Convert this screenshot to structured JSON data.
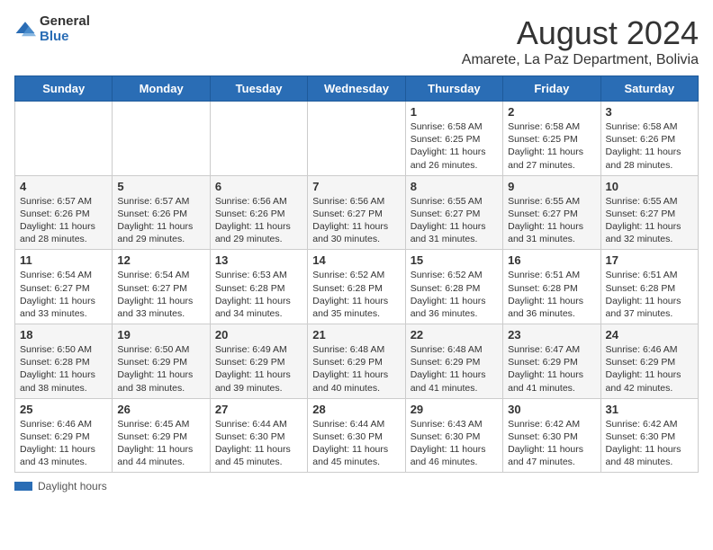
{
  "header": {
    "logo_general": "General",
    "logo_blue": "Blue",
    "month_title": "August 2024",
    "subtitle": "Amarete, La Paz Department, Bolivia"
  },
  "weekdays": [
    "Sunday",
    "Monday",
    "Tuesday",
    "Wednesday",
    "Thursday",
    "Friday",
    "Saturday"
  ],
  "weeks": [
    [
      {
        "day": "",
        "sunrise": "",
        "sunset": "",
        "daylight": ""
      },
      {
        "day": "",
        "sunrise": "",
        "sunset": "",
        "daylight": ""
      },
      {
        "day": "",
        "sunrise": "",
        "sunset": "",
        "daylight": ""
      },
      {
        "day": "",
        "sunrise": "",
        "sunset": "",
        "daylight": ""
      },
      {
        "day": "1",
        "sunrise": "Sunrise: 6:58 AM",
        "sunset": "Sunset: 6:25 PM",
        "daylight": "Daylight: 11 hours and 26 minutes."
      },
      {
        "day": "2",
        "sunrise": "Sunrise: 6:58 AM",
        "sunset": "Sunset: 6:25 PM",
        "daylight": "Daylight: 11 hours and 27 minutes."
      },
      {
        "day": "3",
        "sunrise": "Sunrise: 6:58 AM",
        "sunset": "Sunset: 6:26 PM",
        "daylight": "Daylight: 11 hours and 28 minutes."
      }
    ],
    [
      {
        "day": "4",
        "sunrise": "Sunrise: 6:57 AM",
        "sunset": "Sunset: 6:26 PM",
        "daylight": "Daylight: 11 hours and 28 minutes."
      },
      {
        "day": "5",
        "sunrise": "Sunrise: 6:57 AM",
        "sunset": "Sunset: 6:26 PM",
        "daylight": "Daylight: 11 hours and 29 minutes."
      },
      {
        "day": "6",
        "sunrise": "Sunrise: 6:56 AM",
        "sunset": "Sunset: 6:26 PM",
        "daylight": "Daylight: 11 hours and 29 minutes."
      },
      {
        "day": "7",
        "sunrise": "Sunrise: 6:56 AM",
        "sunset": "Sunset: 6:27 PM",
        "daylight": "Daylight: 11 hours and 30 minutes."
      },
      {
        "day": "8",
        "sunrise": "Sunrise: 6:55 AM",
        "sunset": "Sunset: 6:27 PM",
        "daylight": "Daylight: 11 hours and 31 minutes."
      },
      {
        "day": "9",
        "sunrise": "Sunrise: 6:55 AM",
        "sunset": "Sunset: 6:27 PM",
        "daylight": "Daylight: 11 hours and 31 minutes."
      },
      {
        "day": "10",
        "sunrise": "Sunrise: 6:55 AM",
        "sunset": "Sunset: 6:27 PM",
        "daylight": "Daylight: 11 hours and 32 minutes."
      }
    ],
    [
      {
        "day": "11",
        "sunrise": "Sunrise: 6:54 AM",
        "sunset": "Sunset: 6:27 PM",
        "daylight": "Daylight: 11 hours and 33 minutes."
      },
      {
        "day": "12",
        "sunrise": "Sunrise: 6:54 AM",
        "sunset": "Sunset: 6:27 PM",
        "daylight": "Daylight: 11 hours and 33 minutes."
      },
      {
        "day": "13",
        "sunrise": "Sunrise: 6:53 AM",
        "sunset": "Sunset: 6:28 PM",
        "daylight": "Daylight: 11 hours and 34 minutes."
      },
      {
        "day": "14",
        "sunrise": "Sunrise: 6:52 AM",
        "sunset": "Sunset: 6:28 PM",
        "daylight": "Daylight: 11 hours and 35 minutes."
      },
      {
        "day": "15",
        "sunrise": "Sunrise: 6:52 AM",
        "sunset": "Sunset: 6:28 PM",
        "daylight": "Daylight: 11 hours and 36 minutes."
      },
      {
        "day": "16",
        "sunrise": "Sunrise: 6:51 AM",
        "sunset": "Sunset: 6:28 PM",
        "daylight": "Daylight: 11 hours and 36 minutes."
      },
      {
        "day": "17",
        "sunrise": "Sunrise: 6:51 AM",
        "sunset": "Sunset: 6:28 PM",
        "daylight": "Daylight: 11 hours and 37 minutes."
      }
    ],
    [
      {
        "day": "18",
        "sunrise": "Sunrise: 6:50 AM",
        "sunset": "Sunset: 6:28 PM",
        "daylight": "Daylight: 11 hours and 38 minutes."
      },
      {
        "day": "19",
        "sunrise": "Sunrise: 6:50 AM",
        "sunset": "Sunset: 6:29 PM",
        "daylight": "Daylight: 11 hours and 38 minutes."
      },
      {
        "day": "20",
        "sunrise": "Sunrise: 6:49 AM",
        "sunset": "Sunset: 6:29 PM",
        "daylight": "Daylight: 11 hours and 39 minutes."
      },
      {
        "day": "21",
        "sunrise": "Sunrise: 6:48 AM",
        "sunset": "Sunset: 6:29 PM",
        "daylight": "Daylight: 11 hours and 40 minutes."
      },
      {
        "day": "22",
        "sunrise": "Sunrise: 6:48 AM",
        "sunset": "Sunset: 6:29 PM",
        "daylight": "Daylight: 11 hours and 41 minutes."
      },
      {
        "day": "23",
        "sunrise": "Sunrise: 6:47 AM",
        "sunset": "Sunset: 6:29 PM",
        "daylight": "Daylight: 11 hours and 41 minutes."
      },
      {
        "day": "24",
        "sunrise": "Sunrise: 6:46 AM",
        "sunset": "Sunset: 6:29 PM",
        "daylight": "Daylight: 11 hours and 42 minutes."
      }
    ],
    [
      {
        "day": "25",
        "sunrise": "Sunrise: 6:46 AM",
        "sunset": "Sunset: 6:29 PM",
        "daylight": "Daylight: 11 hours and 43 minutes."
      },
      {
        "day": "26",
        "sunrise": "Sunrise: 6:45 AM",
        "sunset": "Sunset: 6:29 PM",
        "daylight": "Daylight: 11 hours and 44 minutes."
      },
      {
        "day": "27",
        "sunrise": "Sunrise: 6:44 AM",
        "sunset": "Sunset: 6:30 PM",
        "daylight": "Daylight: 11 hours and 45 minutes."
      },
      {
        "day": "28",
        "sunrise": "Sunrise: 6:44 AM",
        "sunset": "Sunset: 6:30 PM",
        "daylight": "Daylight: 11 hours and 45 minutes."
      },
      {
        "day": "29",
        "sunrise": "Sunrise: 6:43 AM",
        "sunset": "Sunset: 6:30 PM",
        "daylight": "Daylight: 11 hours and 46 minutes."
      },
      {
        "day": "30",
        "sunrise": "Sunrise: 6:42 AM",
        "sunset": "Sunset: 6:30 PM",
        "daylight": "Daylight: 11 hours and 47 minutes."
      },
      {
        "day": "31",
        "sunrise": "Sunrise: 6:42 AM",
        "sunset": "Sunset: 6:30 PM",
        "daylight": "Daylight: 11 hours and 48 minutes."
      }
    ]
  ],
  "footer": {
    "daylight_label": "Daylight hours"
  },
  "colors": {
    "header_bg": "#2a6db5",
    "header_text": "#ffffff",
    "row_even": "#efefef",
    "row_odd": "#ffffff",
    "border": "#cccccc"
  }
}
